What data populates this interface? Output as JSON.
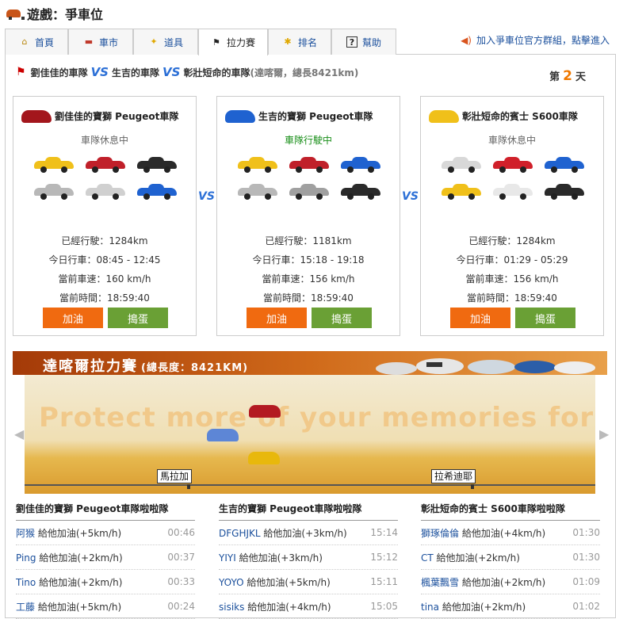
{
  "header": {
    "title": "遊戲：爭車位"
  },
  "tabs": [
    {
      "label": "首頁",
      "icon": "home-icon",
      "glyph": "⌂",
      "color": "#b8860b"
    },
    {
      "label": "車市",
      "icon": "car-icon",
      "glyph": "🚗",
      "color": "#c0392b"
    },
    {
      "label": "道具",
      "icon": "wand-icon",
      "glyph": "✦",
      "color": "#e0a800"
    },
    {
      "label": "拉力賽",
      "icon": "checkered-flag-icon",
      "glyph": "⚑",
      "color": "#222"
    },
    {
      "label": "排名",
      "icon": "star-icon",
      "glyph": "✱",
      "color": "#e0a800"
    },
    {
      "label": "幫助",
      "icon": "help-icon",
      "glyph": "?",
      "color": "#222"
    }
  ],
  "join": {
    "label": "加入爭車位官方群組，點擊進入",
    "icon": "speaker-icon"
  },
  "match": {
    "team1": "劉佳佳的車隊",
    "team2": "生吉的車隊",
    "team3": "彰壯短命的車隊",
    "vs": "VS",
    "info": "(達喀爾，總長8421km)"
  },
  "day": {
    "prefix": "第",
    "number": "2",
    "suffix": "天"
  },
  "teams": [
    {
      "title": "劉佳佳的寶獅 Peugeot車隊",
      "status": "車隊休息中",
      "status_color": "#666",
      "title_car": "#a3161c",
      "cars": [
        "#f0c01a",
        "#c0202a",
        "#2a2a2a",
        "#b8b8b8",
        "#d0d0d0",
        "#1f62d0"
      ],
      "distance": "已經行駛：1284km",
      "today": "今日行車：08:45 - 12:45",
      "speed": "當前車速：160 km/h",
      "time": "當前時間：18:59:40",
      "gas": "加油",
      "trick": "搗蛋"
    },
    {
      "title": "生吉的寶獅 Peugeot車隊",
      "status": "車隊行駛中",
      "status_color": "#1a8f1a",
      "title_car": "#1f62d0",
      "cars": [
        "#f0c01a",
        "#c0202a",
        "#1f62d0",
        "#b8b8b8",
        "#a0a0a0",
        "#2a2a2a"
      ],
      "distance": "已經行駛：1181km",
      "today": "今日行車：15:18 - 19:18",
      "speed": "當前車速：156 km/h",
      "time": "當前時間：18:59:40",
      "gas": "加油",
      "trick": "搗蛋"
    },
    {
      "title": "彰壯短命的賓士 S600車隊",
      "status": "車隊休息中",
      "status_color": "#666",
      "title_car": "#f0c01a",
      "cars": [
        "#d8d8d8",
        "#d0202a",
        "#1f62d0",
        "#f0c01a",
        "#e8e8e8",
        "#2a2a2a"
      ],
      "distance": "已經行駛：1284km",
      "today": "今日行車：01:29 - 05:29",
      "speed": "當前車速：156 km/h",
      "time": "當前時間：18:59:40",
      "gas": "加油",
      "trick": "搗蛋"
    }
  ],
  "vs_mark": "VS",
  "banner": {
    "title": "達喀爾拉力賽",
    "length": "(總長度：8421KM)"
  },
  "track": {
    "slogan": "Protect more of your memories for less!",
    "milestones": [
      "馬拉加",
      "拉希迪耶"
    ]
  },
  "cheers": [
    {
      "title": "劉佳佳的寶獅 Peugeot車隊啦啦隊",
      "rows": [
        {
          "who": "阿猴",
          "msg": "給他加油(+5km/h)",
          "t": "00:46"
        },
        {
          "who": "Ping",
          "msg": "給他加油(+2km/h)",
          "t": "00:37"
        },
        {
          "who": "Tino",
          "msg": "給他加油(+2km/h)",
          "t": "00:33"
        },
        {
          "who": "工藤",
          "msg": "給他加油(+5km/h)",
          "t": "00:24"
        }
      ]
    },
    {
      "title": "生吉的寶獅 Peugeot車隊啦啦隊",
      "rows": [
        {
          "who": "DFGHJKL",
          "msg": "給他加油(+3km/h)",
          "t": "15:14"
        },
        {
          "who": "YIYI",
          "msg": "給他加油(+3km/h)",
          "t": "15:12"
        },
        {
          "who": "YOYO",
          "msg": "給他加油(+5km/h)",
          "t": "15:11"
        },
        {
          "who": "sisiks",
          "msg": "給他加油(+4km/h)",
          "t": "15:05"
        }
      ]
    },
    {
      "title": "彰壯短命的賓士 S600車隊啦啦隊",
      "rows": [
        {
          "who": "獅琢倫倫",
          "msg": "給他加油(+4km/h)",
          "t": "01:30"
        },
        {
          "who": "CT",
          "msg": "給他加油(+2km/h)",
          "t": "01:30"
        },
        {
          "who": "楓葉飄雪",
          "msg": "給他加油(+2km/h)",
          "t": "01:09"
        },
        {
          "who": "tina",
          "msg": "給他加油(+2km/h)",
          "t": "01:02"
        }
      ]
    }
  ]
}
